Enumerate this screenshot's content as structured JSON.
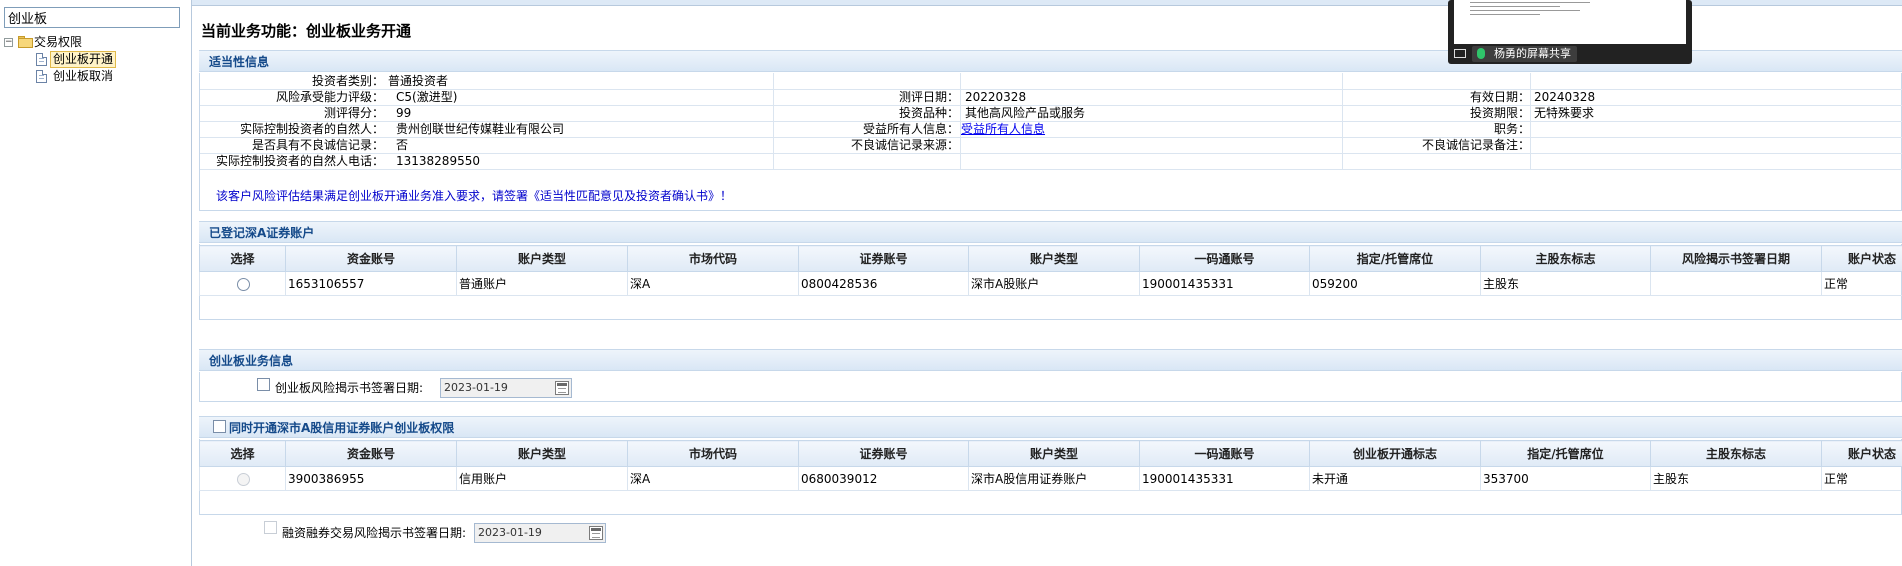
{
  "sidebar": {
    "search_value": "创业板",
    "tree": {
      "root": "交易权限",
      "children": [
        "创业板开通",
        "创业板取消"
      ]
    }
  },
  "page_title": "当前业务功能：创业板业务开通",
  "suitability": {
    "header": "适当性信息",
    "col1": [
      {
        "label": "投资者类别：",
        "value": "普通投资者"
      },
      {
        "label": "风险承受能力评级：",
        "value": "C5(激进型)"
      },
      {
        "label": "测评得分：",
        "value": "99"
      },
      {
        "label": "实际控制投资者的自然人：",
        "value": "贵州创联世纪传媒鞋业有限公司"
      },
      {
        "label": "是否具有不良诚信记录：",
        "value": "否"
      },
      {
        "label": "实际控制投资者的自然人电话：",
        "value": "13138289550"
      }
    ],
    "col2": [
      {
        "label": "测评日期：",
        "value": "20220328"
      },
      {
        "label": "投资品种：",
        "value": "其他高风险产品或服务"
      },
      {
        "label": "受益所有人信息：",
        "value": "受益所有人信息"
      },
      {
        "label": "不良诚信记录来源：",
        "value": ""
      }
    ],
    "col3": [
      {
        "label": "有效日期：",
        "value": "20240328"
      },
      {
        "label": "投资期限：",
        "value": "无特殊要求"
      },
      {
        "label": "职务：",
        "value": ""
      },
      {
        "label": "不良诚信记录备注：",
        "value": ""
      }
    ],
    "notice": "该客户风险评估结果满足创业板开通业务准入要求，请签署《适当性匹配意见及投资者确认书》！"
  },
  "registered_accounts": {
    "header": "已登记深A证券账户",
    "columns": [
      "选择",
      "资金账号",
      "账户类型",
      "市场代码",
      "证券账号",
      "账户类型",
      "一码通账号",
      "指定/托管席位",
      "主股东标志",
      "风险揭示书签署日期",
      "账户状态"
    ],
    "rows": [
      [
        "",
        "1653106557",
        "普通账户",
        "深A",
        "0800428536",
        "深市A股账户",
        "190001435331",
        "059200",
        "主股东",
        "",
        "正常"
      ]
    ]
  },
  "gem_business": {
    "header": "创业板业务信息",
    "risk_label": "创业板风险揭示书签署日期:",
    "risk_date": "2023-01-19"
  },
  "credit_accounts": {
    "header": "同时开通深市A股信用证券账户创业板权限",
    "columns": [
      "选择",
      "资金账号",
      "账户类型",
      "市场代码",
      "证券账号",
      "账户类型",
      "一码通账号",
      "创业板开通标志",
      "指定/托管席位",
      "主股东标志",
      "账户状态"
    ],
    "rows": [
      [
        "",
        "3900386955",
        "信用账户",
        "深A",
        "0680039012",
        "深市A股信用证券账户",
        "190001435331",
        "未开通",
        "353700",
        "主股东",
        "正常"
      ]
    ],
    "margin_label": "融资融券交易风险揭示书签署日期:",
    "margin_date": "2023-01-19"
  },
  "overlay": {
    "share_label": "杨勇的屏幕共享"
  }
}
